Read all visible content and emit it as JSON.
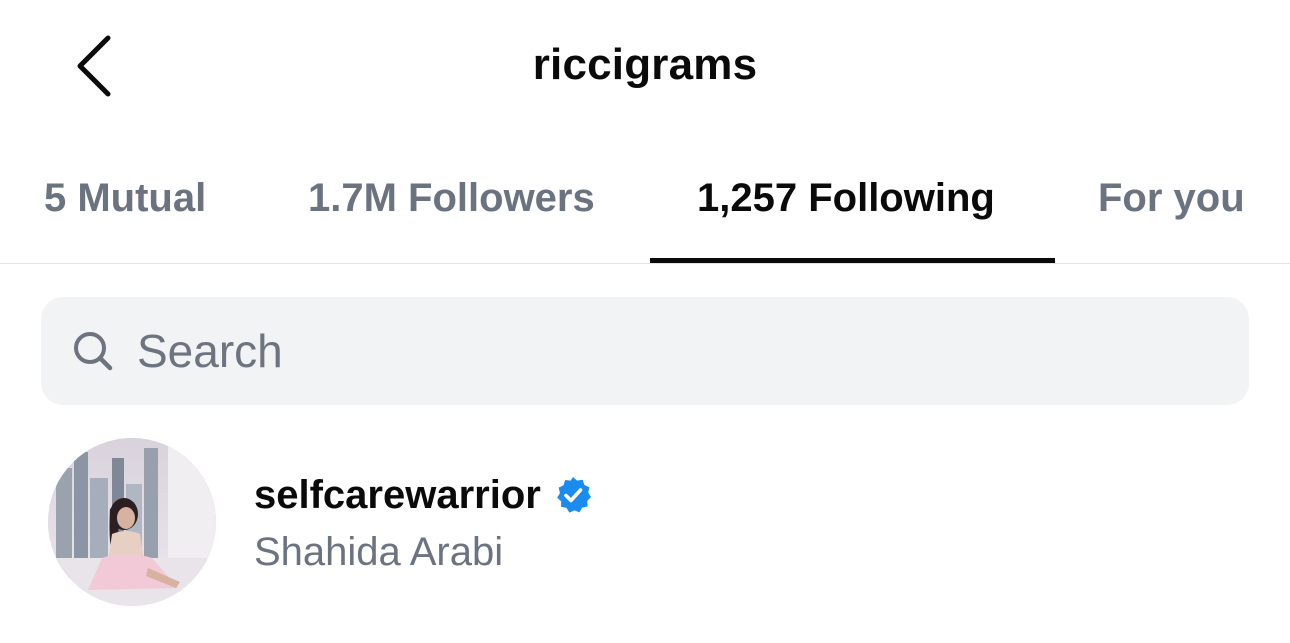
{
  "header": {
    "title": "riccigrams",
    "back_icon": "chevron-left-icon"
  },
  "tabs": [
    {
      "label": "5 Mutual",
      "active": false
    },
    {
      "label": "1.7M Followers",
      "active": false
    },
    {
      "label": "1,257 Following",
      "active": true
    },
    {
      "label": "For you",
      "active": false
    }
  ],
  "search": {
    "placeholder": "Search",
    "value": "",
    "icon": "search-icon"
  },
  "accounts": [
    {
      "username": "selfcarewarrior",
      "full_name": "Shahida Arabi",
      "verified": true,
      "verified_color": "#1a8cf0"
    }
  ],
  "colors": {
    "active_text": "#0a0a0a",
    "inactive_text": "#6b7280",
    "search_bg": "#f2f3f4",
    "verified_blue": "#1a8cf0"
  }
}
